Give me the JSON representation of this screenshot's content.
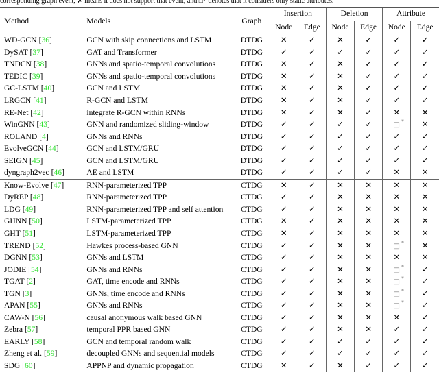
{
  "caption": {
    "text": "corresponding graph event, ✗ means it does not support that event, and □* denotes that it considers only static attributes."
  },
  "table": {
    "columns": {
      "method": "Method",
      "models": "Models",
      "graph": "Graph",
      "groups": [
        {
          "label": "Insertion",
          "sub": [
            "Node",
            "Edge"
          ]
        },
        {
          "label": "Deletion",
          "sub": [
            "Node",
            "Edge"
          ]
        },
        {
          "label": "Attribute",
          "sub": [
            "Node",
            "Edge"
          ]
        }
      ]
    },
    "symbols": {
      "check": "✓",
      "cross": "✕",
      "boxstar": "□",
      "star": "*"
    },
    "sections": [
      {
        "name": "dtdg",
        "rows": [
          {
            "method": "WD-GCN",
            "ref": "36",
            "models": "GCN with skip connections and LSTM",
            "graph": "DTDG",
            "cells": [
              "cross",
              "check",
              "cross",
              "check",
              "check",
              "check"
            ]
          },
          {
            "method": "DySAT",
            "ref": "37",
            "models": "GAT and Transformer",
            "graph": "DTDG",
            "cells": [
              "check",
              "check",
              "check",
              "check",
              "check",
              "check"
            ]
          },
          {
            "method": "TNDCN",
            "ref": "38",
            "models": "GNNs and spatio-temporal convolutions",
            "graph": "DTDG",
            "cells": [
              "cross",
              "check",
              "cross",
              "check",
              "check",
              "check"
            ]
          },
          {
            "method": "TEDIC",
            "ref": "39",
            "models": "GNNs and spatio-temporal convolutions",
            "graph": "DTDG",
            "cells": [
              "cross",
              "check",
              "cross",
              "check",
              "check",
              "check"
            ]
          },
          {
            "method": "GC-LSTM",
            "ref": "40",
            "models": "GCN and LSTM",
            "graph": "DTDG",
            "cells": [
              "cross",
              "check",
              "cross",
              "check",
              "check",
              "check"
            ]
          },
          {
            "method": "LRGCN",
            "ref": "41",
            "models": "R-GCN and LSTM",
            "graph": "DTDG",
            "cells": [
              "cross",
              "check",
              "cross",
              "check",
              "check",
              "check"
            ]
          },
          {
            "method": "RE-Net",
            "ref": "42",
            "models": "integrate R-GCN within RNNs",
            "graph": "DTDG",
            "cells": [
              "cross",
              "check",
              "cross",
              "check",
              "cross",
              "cross"
            ]
          },
          {
            "method": "WinGNN",
            "ref": "43",
            "models": "GNN and randomized sliding-window",
            "graph": "DTDG",
            "cells": [
              "check",
              "check",
              "check",
              "check",
              "boxstar",
              "cross"
            ]
          },
          {
            "method": "ROLAND",
            "ref": "4",
            "models": "GNNs and RNNs",
            "graph": "DTDG",
            "cells": [
              "check",
              "check",
              "check",
              "check",
              "check",
              "check"
            ]
          },
          {
            "method": "EvolveGCN",
            "ref": "44",
            "models": "GCN and LSTM/GRU",
            "graph": "DTDG",
            "cells": [
              "check",
              "check",
              "check",
              "check",
              "check",
              "check"
            ]
          },
          {
            "method": "SEIGN",
            "ref": "45",
            "models": "GCN and LSTM/GRU",
            "graph": "DTDG",
            "cells": [
              "check",
              "check",
              "check",
              "check",
              "check",
              "check"
            ]
          },
          {
            "method": "dyngraph2vec",
            "ref": "46",
            "models": "AE and LSTM",
            "graph": "DTDG",
            "cells": [
              "check",
              "check",
              "check",
              "check",
              "cross",
              "cross"
            ]
          }
        ]
      },
      {
        "name": "ctdg",
        "rows": [
          {
            "method": "Know-Evolve",
            "ref": "47",
            "models": "RNN-parameterized TPP",
            "graph": "CTDG",
            "cells": [
              "cross",
              "check",
              "cross",
              "cross",
              "cross",
              "cross"
            ]
          },
          {
            "method": "DyREP",
            "ref": "48",
            "models": "RNN-parameterized TPP",
            "graph": "CTDG",
            "cells": [
              "check",
              "check",
              "cross",
              "cross",
              "cross",
              "cross"
            ]
          },
          {
            "method": "LDG",
            "ref": "49",
            "models": "RNN-parameterized TPP and self attention",
            "graph": "CTDG",
            "cells": [
              "check",
              "check",
              "cross",
              "cross",
              "cross",
              "cross"
            ]
          },
          {
            "method": "GHNN",
            "ref": "50",
            "models": "LSTM-parameterized TPP",
            "graph": "CTDG",
            "cells": [
              "cross",
              "check",
              "cross",
              "cross",
              "cross",
              "cross"
            ]
          },
          {
            "method": "GHT",
            "ref": "51",
            "models": "LSTM-parameterized TPP",
            "graph": "CTDG",
            "cells": [
              "cross",
              "check",
              "cross",
              "cross",
              "cross",
              "cross"
            ]
          },
          {
            "method": "TREND",
            "ref": "52",
            "models": "Hawkes process-based GNN",
            "graph": "CTDG",
            "cells": [
              "check",
              "check",
              "cross",
              "cross",
              "boxstar",
              "cross"
            ]
          },
          {
            "method": "DGNN",
            "ref": "53",
            "models": "GNNs and LSTM",
            "graph": "CTDG",
            "cells": [
              "check",
              "check",
              "cross",
              "cross",
              "cross",
              "cross"
            ]
          },
          {
            "method": "JODIE",
            "ref": "54",
            "models": "GNNs and RNNs",
            "graph": "CTDG",
            "cells": [
              "check",
              "check",
              "cross",
              "cross",
              "boxstar",
              "check"
            ]
          },
          {
            "method": "TGAT",
            "ref": "2",
            "models": "GAT, time encode and RNNs",
            "graph": "CTDG",
            "cells": [
              "check",
              "check",
              "cross",
              "cross",
              "boxstar",
              "check"
            ]
          },
          {
            "method": "TGN",
            "ref": "3",
            "models": "GNNs, time encode and RNNs",
            "graph": "CTDG",
            "cells": [
              "check",
              "check",
              "cross",
              "cross",
              "boxstar",
              "check"
            ]
          },
          {
            "method": "APAN",
            "ref": "55",
            "models": "GNNs and RNNs",
            "graph": "CTDG",
            "cells": [
              "check",
              "check",
              "cross",
              "cross",
              "boxstar",
              "check"
            ]
          },
          {
            "method": "CAW-N",
            "ref": "56",
            "models": "causal anonymous walk based GNN",
            "graph": "CTDG",
            "cells": [
              "check",
              "check",
              "cross",
              "cross",
              "cross",
              "check"
            ]
          },
          {
            "method": "Zebra",
            "ref": "57",
            "models": "temporal PPR based GNN",
            "graph": "CTDG",
            "cells": [
              "check",
              "check",
              "cross",
              "cross",
              "check",
              "check"
            ]
          },
          {
            "method": "EARLY",
            "ref": "58",
            "models": "GCN and temporal random walk",
            "graph": "CTDG",
            "cells": [
              "check",
              "check",
              "check",
              "check",
              "check",
              "check"
            ]
          },
          {
            "method": "Zheng et al.",
            "ref": "59",
            "models": "decoupled GNNs and sequential models",
            "graph": "CTDG",
            "cells": [
              "check",
              "check",
              "check",
              "check",
              "check",
              "check"
            ]
          },
          {
            "method": "SDG",
            "ref": "60",
            "models": "APPNP and dynamic propagation",
            "graph": "CTDG",
            "cells": [
              "cross",
              "check",
              "cross",
              "check",
              "check",
              "check"
            ]
          }
        ]
      }
    ]
  },
  "colors": {
    "reference_green": "#2ee02e",
    "rule": "#555555",
    "text": "#000000"
  }
}
